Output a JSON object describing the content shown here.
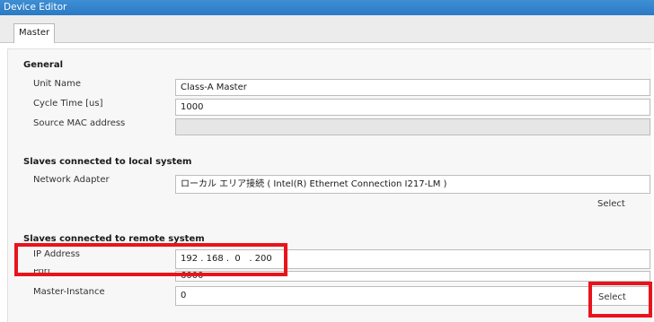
{
  "window": {
    "title": "Device Editor"
  },
  "tabs": [
    {
      "label": "Master"
    }
  ],
  "general": {
    "heading": "General",
    "unit_name": {
      "label": "Unit Name",
      "value": "Class-A Master"
    },
    "cycle_time": {
      "label": "Cycle Time [us]",
      "value": "1000"
    },
    "source_mac": {
      "label": "Source MAC address",
      "value": ""
    }
  },
  "local": {
    "heading": "Slaves connected to local system",
    "network_adapter": {
      "label": "Network Adapter",
      "value": "ローカル エリア接続 ( Intel(R) Ethernet Connection I217-LM )"
    },
    "select_label": "Select"
  },
  "remote": {
    "heading": "Slaves connected to remote system",
    "ip_address": {
      "label": "IP Address",
      "value": "192 . 168 .  0   . 200"
    },
    "port": {
      "label": "Port",
      "value": "6000"
    },
    "master_instance": {
      "label": "Master-Instance",
      "value": "0"
    },
    "select_label": "Select"
  },
  "colors": {
    "titlebar": "#2a79c4",
    "highlight": "#e8141c"
  }
}
